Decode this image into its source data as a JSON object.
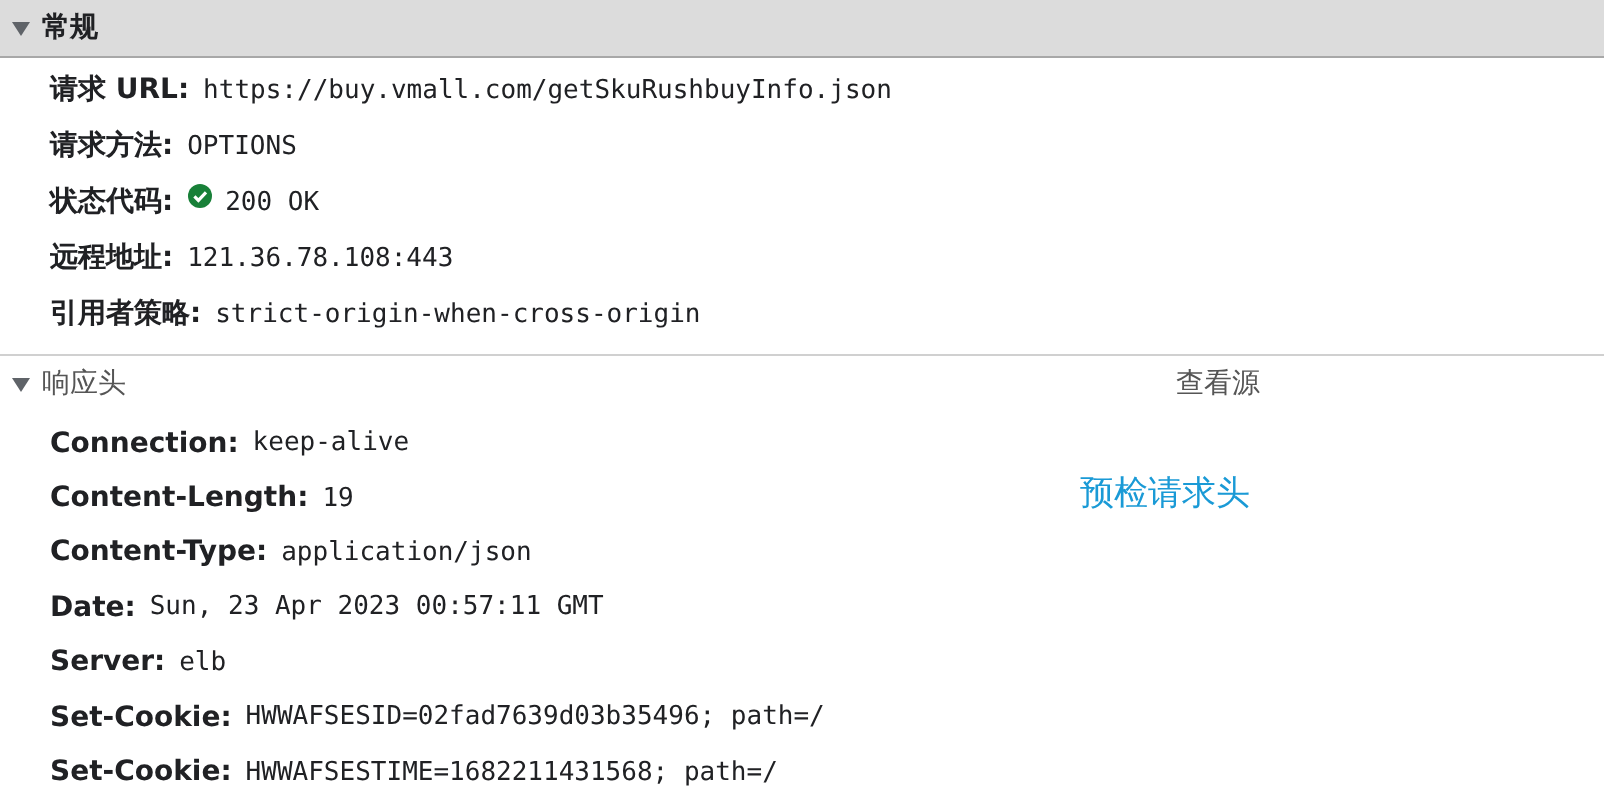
{
  "sections": [
    {
      "title": "常规",
      "expanded": true,
      "highlighted": true,
      "rows": [
        {
          "kind": "text",
          "label": "请求 URL:",
          "value": "https://buy.vmall.com/getSkuRushbuyInfo.json"
        },
        {
          "kind": "text",
          "label": "请求方法:",
          "value": "OPTIONS"
        },
        {
          "kind": "status",
          "label": "状态代码:",
          "value": "200 OK"
        },
        {
          "kind": "text",
          "label": "远程地址:",
          "value": "121.36.78.108:443"
        },
        {
          "kind": "text",
          "label": "引用者策略:",
          "value": "strict-origin-when-cross-origin"
        }
      ]
    },
    {
      "title": "响应头",
      "expanded": true,
      "highlighted": false,
      "link": "查看源",
      "note": "预检请求头",
      "rows": [
        {
          "kind": "text",
          "label": "Connection:",
          "value": "keep-alive"
        },
        {
          "kind": "text",
          "label": "Content-Length:",
          "value": "19"
        },
        {
          "kind": "text",
          "label": "Content-Type:",
          "value": "application/json"
        },
        {
          "kind": "text",
          "label": "Date:",
          "value": "Sun, 23 Apr 2023 00:57:11 GMT"
        },
        {
          "kind": "text",
          "label": "Server:",
          "value": "elb"
        },
        {
          "kind": "text",
          "label": "Set-Cookie:",
          "value": "HWWAFSESID=02fad7639d03b35496; path=/"
        },
        {
          "kind": "text",
          "label": "Set-Cookie:",
          "value": "HWWAFSESTIME=1682211431568; path=/"
        }
      ]
    }
  ]
}
